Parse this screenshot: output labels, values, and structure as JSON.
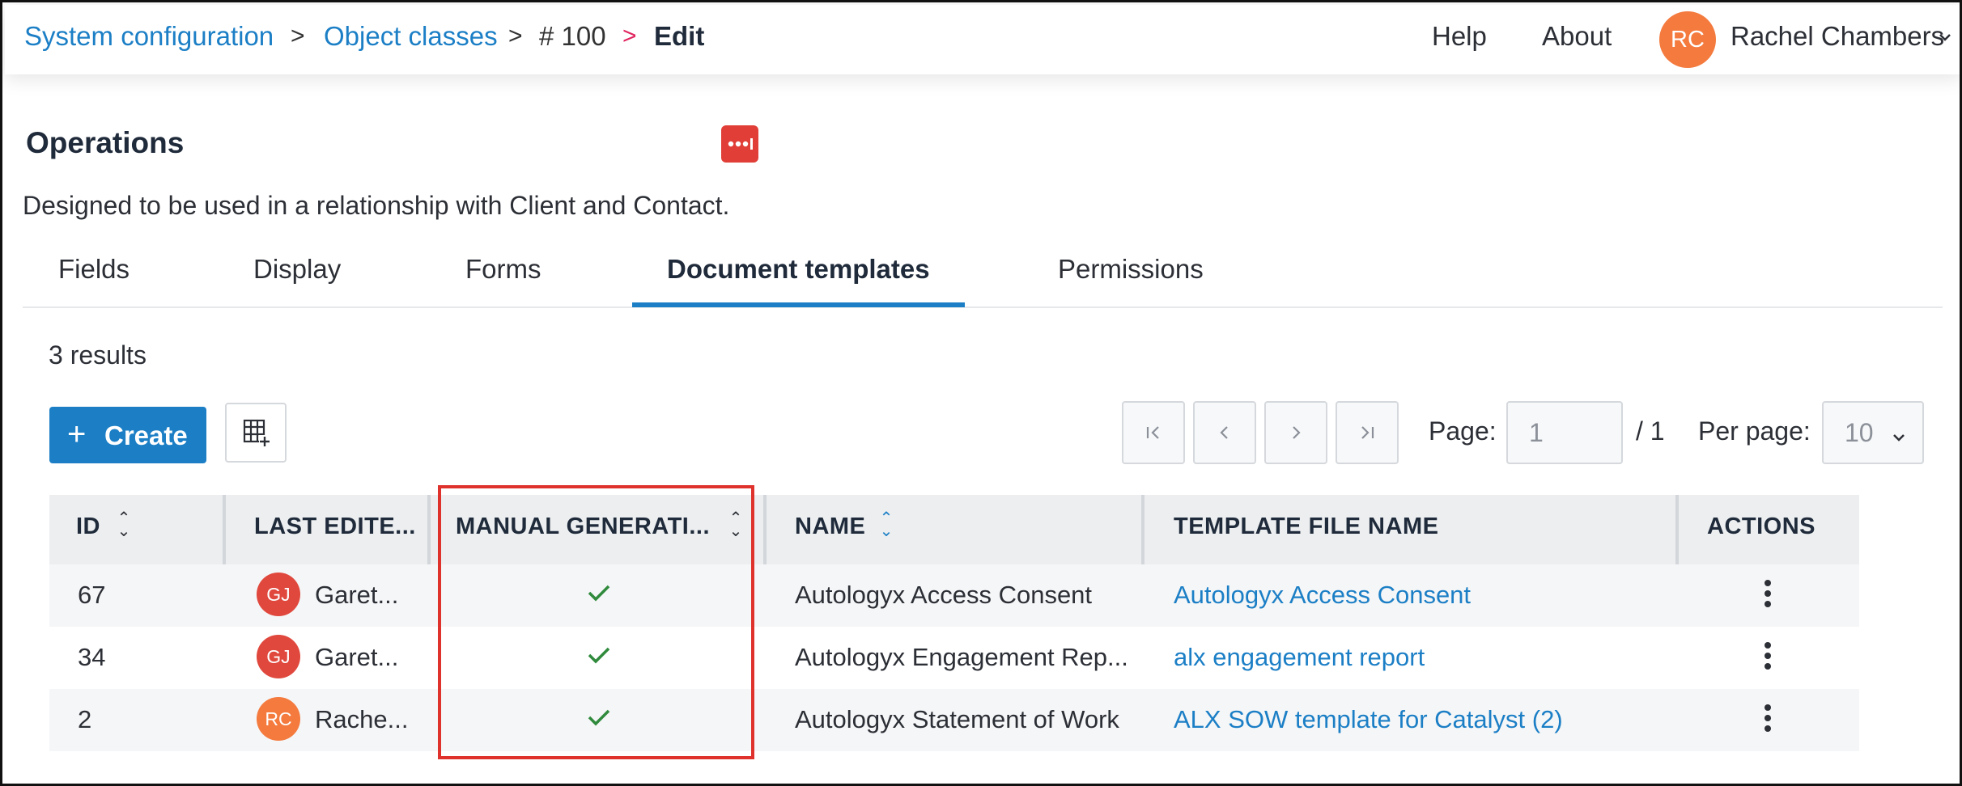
{
  "breadcrumb": {
    "items": [
      "System configuration",
      "Object classes",
      "# 100",
      "Edit"
    ]
  },
  "topnav": {
    "help": "Help",
    "about": "About",
    "user_initials": "RC",
    "user_name": "Rachel Chambers"
  },
  "header": {
    "title": "Operations",
    "description": "Designed to be used in a relationship with Client and Contact."
  },
  "tabs": [
    {
      "label": "Fields",
      "active": false
    },
    {
      "label": "Display",
      "active": false
    },
    {
      "label": "Forms",
      "active": false
    },
    {
      "label": "Document templates",
      "active": true
    },
    {
      "label": "Permissions",
      "active": false
    }
  ],
  "results_text": "3 results",
  "toolbar": {
    "create_label": "Create"
  },
  "pagination": {
    "page_label": "Page:",
    "page_value": "1",
    "total_pages": "/ 1",
    "per_page_label": "Per page:",
    "per_page_value": "10"
  },
  "table": {
    "columns": [
      "ID",
      "LAST EDITE...",
      "MANUAL GENERATI...",
      "NAME",
      "TEMPLATE FILE NAME",
      "ACTIONS"
    ],
    "rows": [
      {
        "id": "67",
        "editor_initials": "GJ",
        "editor_name": "Garet...",
        "manual": true,
        "name": "Autologyx Access Consent",
        "template_file": "Autologyx Access Consent"
      },
      {
        "id": "34",
        "editor_initials": "GJ",
        "editor_name": "Garet...",
        "manual": true,
        "name": "Autologyx Engagement Rep...",
        "template_file": "alx engagement report"
      },
      {
        "id": "2",
        "editor_initials": "RC",
        "editor_name": "Rache...",
        "manual": true,
        "name": "Autologyx Statement of Work",
        "template_file": "ALX SOW template for Catalyst (2)"
      }
    ]
  },
  "colors": {
    "accent": "#1c7fc6",
    "highlight": "#e0322d",
    "check": "#2f8a3c",
    "avatar_orange": "#f47a3e",
    "avatar_red": "#e0483d"
  }
}
